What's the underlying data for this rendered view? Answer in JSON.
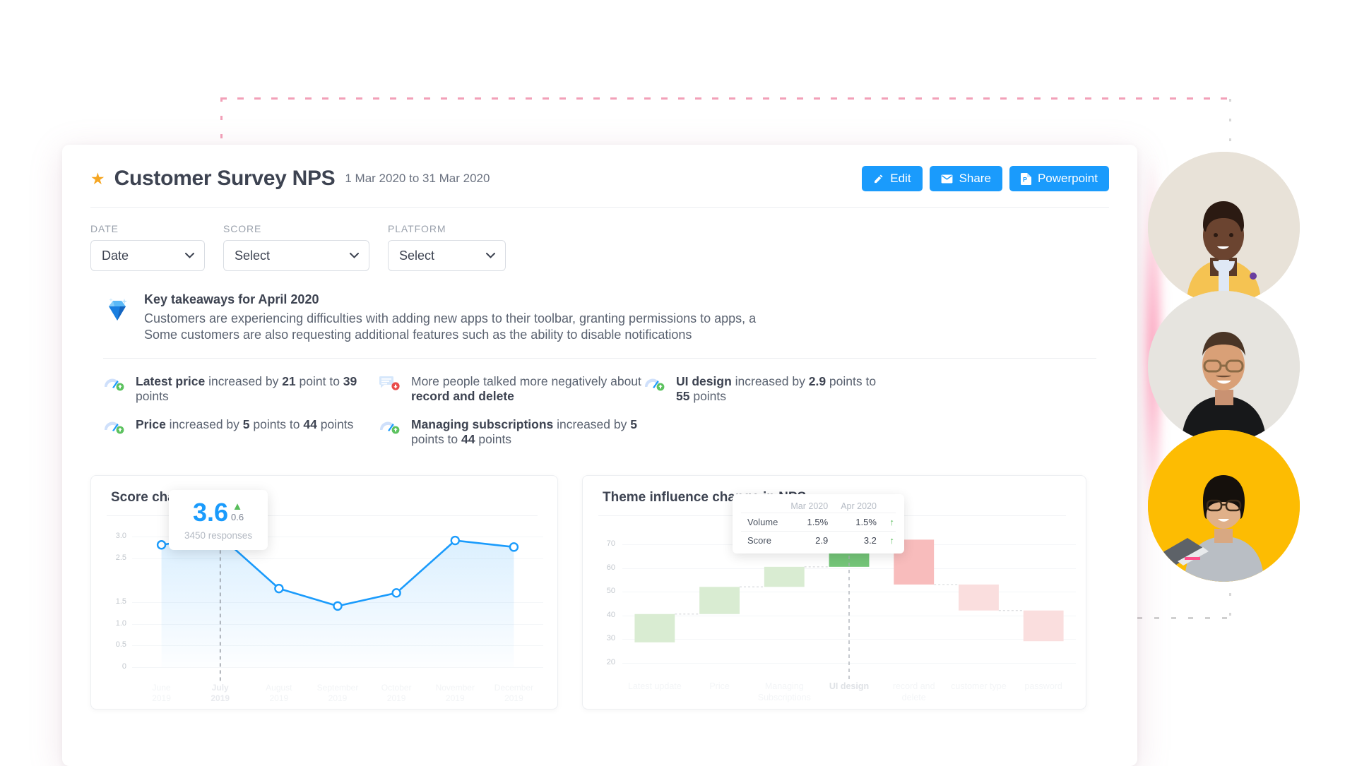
{
  "header": {
    "star_icon": "star-icon",
    "title": "Customer Survey NPS",
    "date_range": "1 Mar 2020 to 31 Mar 2020",
    "buttons": [
      {
        "label": "Edit",
        "icon": "pencil-icon"
      },
      {
        "label": "Share",
        "icon": "envelope-icon"
      },
      {
        "label": "Powerpoint",
        "icon": "powerpoint-icon"
      }
    ]
  },
  "filters": [
    {
      "label": "DATE",
      "value": "Date"
    },
    {
      "label": "SCORE",
      "value": "Select"
    },
    {
      "label": "PLATFORM",
      "value": "Select"
    }
  ],
  "takeaways": {
    "icon": "diamond-icon",
    "title": "Key takeaways for April 2020",
    "line1": "Customers are experiencing difficulties with adding new apps to their toolbar, granting permissions to apps, a",
    "line2": "Some customers are also requesting additional features such as the ability to disable notifications"
  },
  "insights": [
    {
      "icon": "gauge-up-icon",
      "parts": [
        {
          "text": "Latest price",
          "bold": true
        },
        {
          "text": " increased by ",
          "bold": false
        },
        {
          "text": "21",
          "bold": true
        },
        {
          "text": " point to ",
          "bold": false
        },
        {
          "text": "39",
          "bold": true
        },
        {
          "text": " points",
          "bold": false
        }
      ]
    },
    {
      "icon": "negative-comment-icon",
      "parts": [
        {
          "text": "More people talked more negatively about ",
          "bold": false
        },
        {
          "text": "record and delete",
          "bold": true
        }
      ]
    },
    {
      "icon": "gauge-up-icon",
      "parts": [
        {
          "text": "UI design",
          "bold": true
        },
        {
          "text": " increased by ",
          "bold": false
        },
        {
          "text": "2.9",
          "bold": true
        },
        {
          "text": " points to ",
          "bold": false
        },
        {
          "text": "55",
          "bold": true
        },
        {
          "text": " points",
          "bold": false
        }
      ]
    },
    {
      "icon": "gauge-up-icon",
      "parts": [
        {
          "text": "Price",
          "bold": true
        },
        {
          "text": " increased by ",
          "bold": false
        },
        {
          "text": "5",
          "bold": true
        },
        {
          "text": " points to ",
          "bold": false
        },
        {
          "text": "44",
          "bold": true
        },
        {
          "text": " points",
          "bold": false
        }
      ]
    },
    {
      "icon": "gauge-up-icon",
      "parts": [
        {
          "text": "Managing subscriptions",
          "bold": true
        },
        {
          "text": " increased by ",
          "bold": false
        },
        {
          "text": "5",
          "bold": true
        },
        {
          "text": " points to ",
          "bold": false
        },
        {
          "text": "44",
          "bold": true
        },
        {
          "text": " points",
          "bold": false
        }
      ]
    }
  ],
  "line_tooltip": {
    "value": "3.6",
    "arrow": "▲",
    "delta": "0.6",
    "responses": "3450 responses"
  },
  "waterfall_tooltip": {
    "columns": [
      "Mar 2020",
      "Apr 2020"
    ],
    "rows": [
      {
        "label": "Volume",
        "mar": "1.5%",
        "apr": "1.5%",
        "arrow": "↑"
      },
      {
        "label": "Score",
        "mar": "2.9",
        "apr": "3.2",
        "arrow": "↑"
      }
    ]
  },
  "colors": {
    "accent_blue": "#1a9bfc",
    "star_orange": "#f5a623",
    "up_green": "#58bd5b",
    "down_red": "#f4a0a0",
    "text_dark": "#3d4351",
    "text_muted": "#9aa1ac"
  },
  "chart_data": [
    {
      "type": "line",
      "title": "Score change over time",
      "categories": [
        "June 2019",
        "July 2019",
        "August 2019",
        "September 2019",
        "October 2019",
        "November 2019",
        "December 2019"
      ],
      "month_labels": [
        "June",
        "July",
        "August",
        "September",
        "October",
        "November",
        "December"
      ],
      "year_labels": [
        "2019",
        "2019",
        "2019",
        "2019",
        "2019",
        "2019",
        "2019"
      ],
      "values": [
        2.8,
        3.0,
        1.8,
        1.4,
        1.7,
        2.9,
        2.75
      ],
      "highlighted_index": 1,
      "ytick_labels": [
        "3.0",
        "2.5",
        "1.5",
        "1.0",
        "0.5",
        "0"
      ],
      "ytick_values": [
        3.0,
        2.5,
        1.5,
        1.0,
        0.5,
        0
      ],
      "ylim": [
        0,
        3.2
      ],
      "xlabel": "",
      "ylabel": "",
      "grid": true,
      "legend": "none",
      "area_fill": true
    },
    {
      "type": "bar",
      "subtype": "waterfall",
      "title": "Theme influence change in NPS",
      "categories": [
        "Latest update",
        "Price",
        "Managing Subscriptions",
        "UI design",
        "record and delete",
        "customer type",
        "password"
      ],
      "category_lines": [
        [
          "Latest update"
        ],
        [
          "Price"
        ],
        [
          "Managing",
          "Subscriptions"
        ],
        [
          "UI design"
        ],
        [
          "record and",
          "delete"
        ],
        [
          "customer type"
        ],
        [
          "password"
        ]
      ],
      "highlighted_index": 3,
      "bar_start": [
        28.5,
        40.5,
        52.0,
        60.5,
        72.0,
        53.0,
        42.0
      ],
      "bar_end": [
        40.5,
        52.0,
        60.5,
        72.0,
        53.0,
        42.0,
        29.0
      ],
      "directions": [
        "up",
        "up",
        "up",
        "up",
        "down",
        "down",
        "down"
      ],
      "ytick_labels": [
        "70",
        "60",
        "50",
        "40",
        "30",
        "20"
      ],
      "ytick_values": [
        70,
        60,
        50,
        40,
        30,
        20
      ],
      "ylim": [
        18,
        76
      ],
      "xlabel": "",
      "ylabel": "",
      "grid": true,
      "legend": "none"
    }
  ],
  "photos": [
    {
      "name": "portrait-woman-yellow-blazer"
    },
    {
      "name": "portrait-man-glasses-black-shirt"
    },
    {
      "name": "portrait-woman-laptop-yellow-background"
    }
  ]
}
